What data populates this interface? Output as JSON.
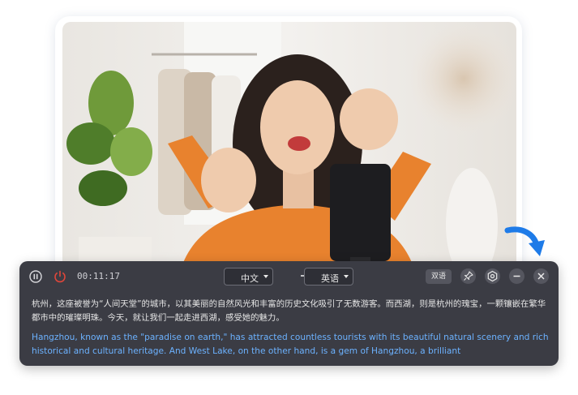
{
  "player": {
    "timer": "00:11:17",
    "source_lang": "中文",
    "target_lang": "英语",
    "bilingual_label": "双语",
    "icons": [
      "pause-icon",
      "power-icon",
      "swap-arrow-icon",
      "pin-icon",
      "settings-icon",
      "minimize-icon",
      "close-icon"
    ]
  },
  "subtitles": {
    "source": "杭州，这座被誉为“人间天堂”的城市，以其美丽的自然风光和丰富的历史文化吸引了无数游客。而西湖，则是杭州的瑰宝，一颗镶嵌在繁华都市中的璀璨明珠。今天，就让我们一起走进西湖，感受她的魅力。",
    "target": "Hangzhou, known as the \"paradise on earth,\" has attracted countless tourists with its beautiful natural scenery and rich historical and cultural heritage. And West Lake, on the other hand, is a gem of Hangzhou, a brilliant"
  },
  "colors": {
    "panel_bg": "#3b3c44",
    "target_text": "#6cb2ff",
    "power_red": "#e0463a",
    "arrow_blue": "#1e7be8"
  }
}
